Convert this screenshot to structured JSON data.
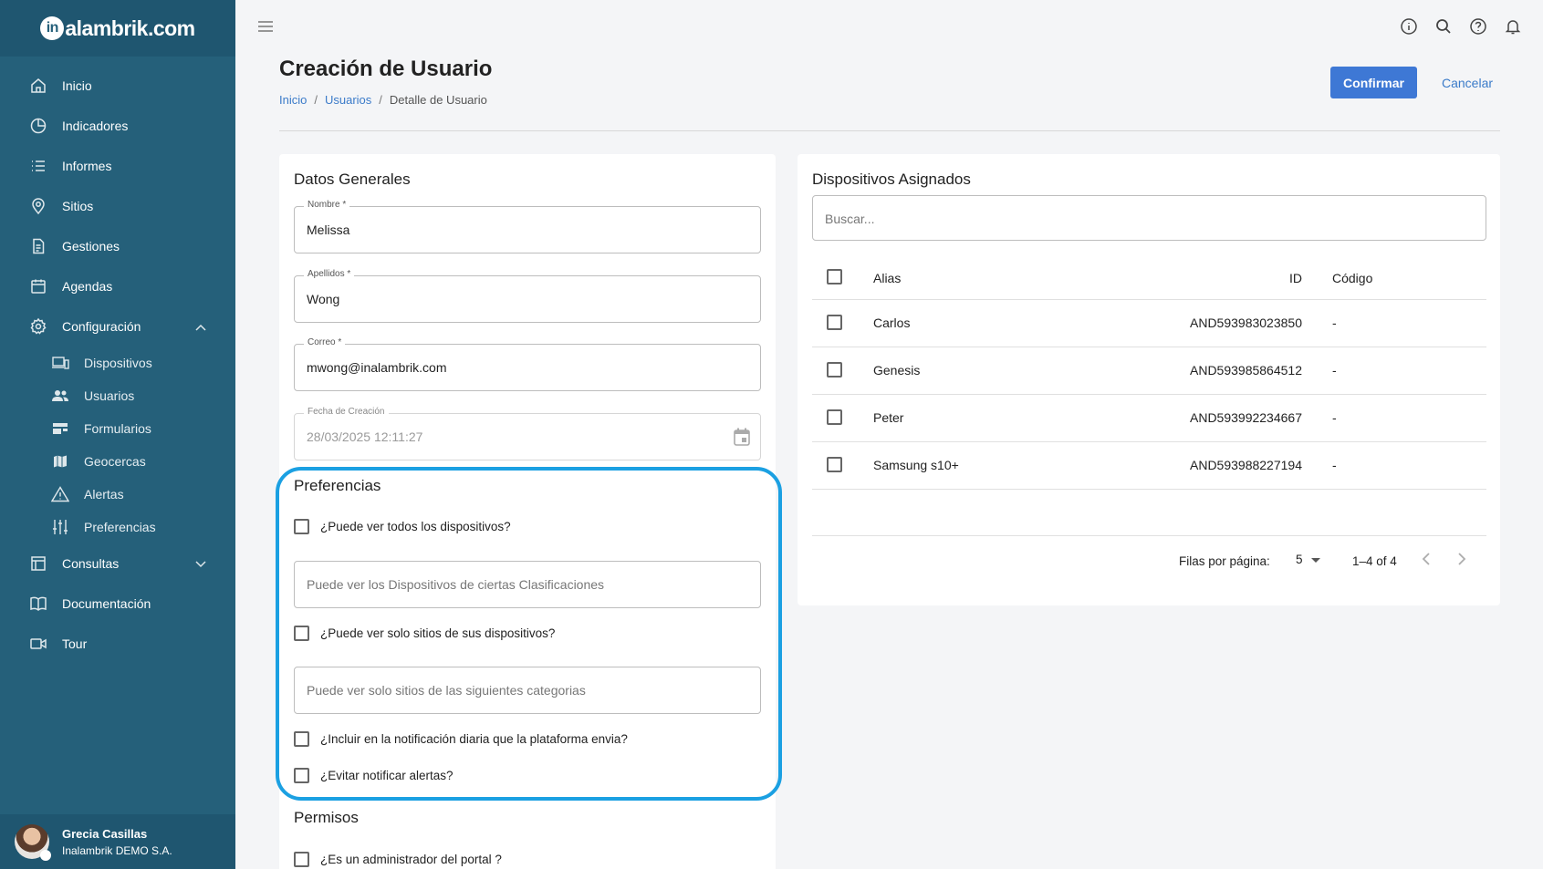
{
  "brand": {
    "logo_badge": "in",
    "logo_text": "alambrik.com"
  },
  "sidebar": {
    "items": [
      {
        "label": "Inicio",
        "icon": "home-icon"
      },
      {
        "label": "Indicadores",
        "icon": "pie-chart-icon"
      },
      {
        "label": "Informes",
        "icon": "list-icon"
      },
      {
        "label": "Sitios",
        "icon": "location-pin-icon"
      },
      {
        "label": "Gestiones",
        "icon": "document-icon"
      },
      {
        "label": "Agendas",
        "icon": "calendar-icon"
      },
      {
        "label": "Configuración",
        "icon": "gear-icon",
        "expanded": true
      },
      {
        "label": "Consultas",
        "icon": "table-icon",
        "expanded": false
      },
      {
        "label": "Documentación",
        "icon": "book-icon"
      },
      {
        "label": "Tour",
        "icon": "video-icon"
      }
    ],
    "config_sub": [
      {
        "label": "Dispositivos",
        "icon": "devices-icon"
      },
      {
        "label": "Usuarios",
        "icon": "people-icon"
      },
      {
        "label": "Formularios",
        "icon": "forms-icon"
      },
      {
        "label": "Geocercas",
        "icon": "map-icon"
      },
      {
        "label": "Alertas",
        "icon": "warning-icon"
      },
      {
        "label": "Preferencias",
        "icon": "sliders-icon"
      }
    ]
  },
  "user": {
    "name": "Grecia Casillas",
    "org": "Inalambrik DEMO S.A."
  },
  "page": {
    "title": "Creación de Usuario",
    "breadcrumb": [
      "Inicio",
      "Usuarios",
      "Detalle de Usuario"
    ],
    "confirm_label": "Confirmar",
    "cancel_label": "Cancelar"
  },
  "general": {
    "title": "Datos Generales",
    "fields": [
      {
        "label": "Nombre *",
        "value": "Melissa"
      },
      {
        "label": "Apellidos *",
        "value": "Wong"
      },
      {
        "label": "Correo *",
        "value": "mwong@inalambrik.com"
      },
      {
        "label": "Fecha de Creación",
        "value": "28/03/2025 12:11:27",
        "disabled": true
      }
    ]
  },
  "preferences": {
    "title": "Preferencias",
    "see_all_devices": "¿Puede ver todos los dispositivos?",
    "classifications_placeholder": "Puede ver los Dispositivos de ciertas Clasificaciones",
    "only_sites": "¿Puede ver solo sitios de sus dispositivos?",
    "site_categories_placeholder": "Puede ver solo sitios de las siguientes categorias",
    "daily_notification": "¿Incluir en la notificación diaria que la plataforma envia?",
    "avoid_alerts": "¿Evitar notificar alertas?"
  },
  "permissions": {
    "title": "Permisos",
    "is_admin": "¿Es un administrador del portal ?"
  },
  "devices": {
    "title": "Dispositivos Asignados",
    "search_placeholder": "Buscar...",
    "columns": {
      "alias": "Alias",
      "id": "ID",
      "code": "Código"
    },
    "rows": [
      {
        "alias": "Carlos",
        "id": "AND593983023850",
        "code": "-"
      },
      {
        "alias": "Genesis",
        "id": "AND593985864512",
        "code": "-"
      },
      {
        "alias": "Peter",
        "id": "AND593992234667",
        "code": "-"
      },
      {
        "alias": "Samsung s10+",
        "id": "AND593988227194",
        "code": "-"
      }
    ],
    "pager": {
      "rows_label": "Filas por página:",
      "rows_value": "5",
      "range": "1–4 of 4"
    }
  },
  "colors": {
    "sidebar": "#25607a",
    "accent": "#3e78d5",
    "highlight": "#1ba0e2"
  }
}
